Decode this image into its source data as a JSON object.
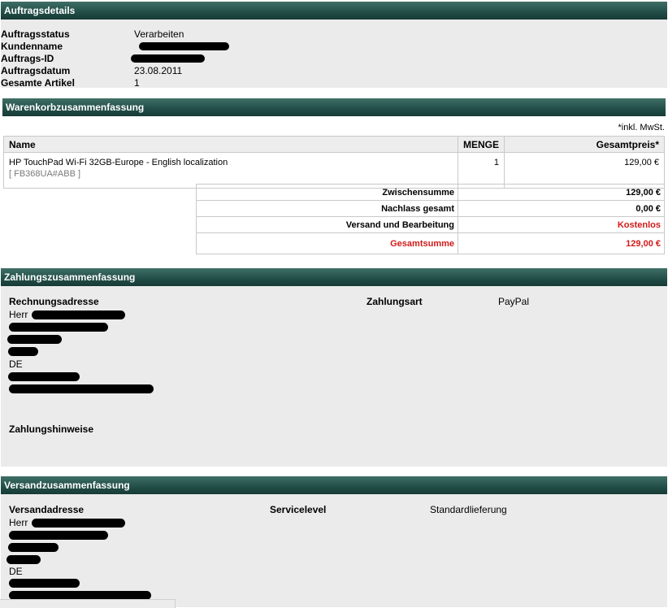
{
  "order_details": {
    "header": "Auftragsdetails",
    "rows": [
      {
        "label": "Auftragsstatus",
        "value": "Verarbeiten"
      },
      {
        "label": "Kundenname",
        "value": ""
      },
      {
        "label": "Auftrags-ID",
        "value": ""
      },
      {
        "label": "Auftragsdatum",
        "value": "23.08.2011"
      },
      {
        "label": "Gesamte Artikel",
        "value": "1"
      }
    ]
  },
  "cart": {
    "header": "Warenkorbzusammenfassung",
    "tax_note": "*inkl. MwSt.",
    "columns": [
      "Name",
      "MENGE",
      "Gesamtpreis*"
    ],
    "items": [
      {
        "name": "HP TouchPad Wi-Fi 32GB-Europe - English localization",
        "sku": "[ FB368UA#ABB ]",
        "qty": "1",
        "price": "129,00 €"
      }
    ],
    "totals": [
      {
        "label": "Zwischensumme",
        "value": "129,00 €"
      },
      {
        "label": "Nachlass gesamt",
        "value": "0,00 €"
      },
      {
        "label": "Versand und Bearbeitung",
        "value": "Kostenlos"
      },
      {
        "label": "Gesamtsumme",
        "value": "129,00 €"
      }
    ]
  },
  "payment": {
    "header": "Zahlungszusammenfassung",
    "billing_label": "Rechnungsadresse",
    "salutation": "Herr",
    "country": "DE",
    "method_label": "Zahlungsart",
    "method_value": "PayPal",
    "notes_label": "Zahlungshinweise"
  },
  "shipping": {
    "header": "Versandzusammenfassung",
    "address_label": "Versandadresse",
    "salutation": "Herr",
    "country": "DE",
    "service_label": "Servicelevel",
    "service_value": "Standardlieferung"
  },
  "colors": {
    "header_bg": "#24504a",
    "panel_bg": "#ebebeb",
    "accent_red": "#d21a1a"
  }
}
